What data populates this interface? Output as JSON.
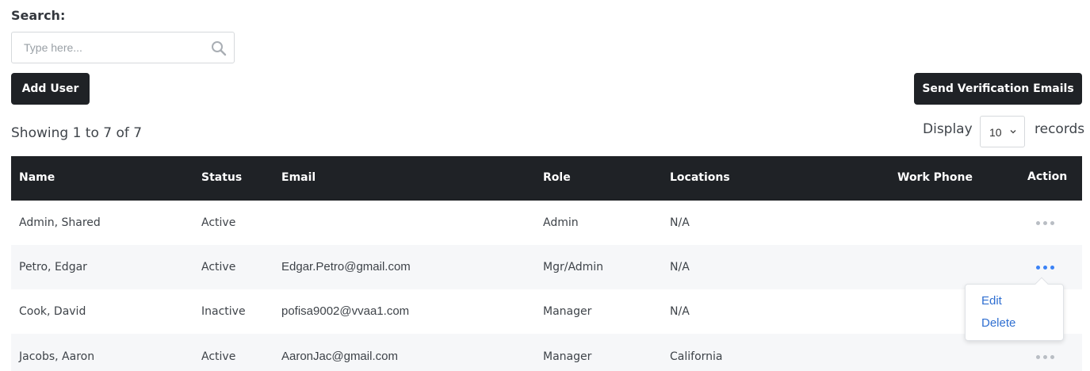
{
  "search": {
    "label": "Search:",
    "placeholder": "Type here...",
    "value": "",
    "icon": "search-icon"
  },
  "buttons": {
    "add_user": "Add User",
    "send_verification": "Send Verification Emails"
  },
  "summary": {
    "showing": "Showing 1 to 7 of 7"
  },
  "pagination": {
    "display_label": "Display",
    "page_size": "10",
    "records_label": "records"
  },
  "table": {
    "columns": {
      "name": "Name",
      "status": "Status",
      "email": "Email",
      "role": "Role",
      "locations": "Locations",
      "work_phone": "Work Phone",
      "action": "Action"
    },
    "rows": [
      {
        "name": "Admin, Shared",
        "status": "Active",
        "email": "",
        "role": "Admin",
        "locations": "N/A",
        "work_phone": ""
      },
      {
        "name": "Petro, Edgar",
        "status": "Active",
        "email": "Edgar.Petro@gmail.com",
        "role": "Mgr/Admin",
        "locations": "N/A",
        "work_phone": ""
      },
      {
        "name": "Cook, David",
        "status": "Inactive",
        "email": "pofisa9002@vvaa1.com",
        "role": "Manager",
        "locations": "N/A",
        "work_phone": ""
      },
      {
        "name": "Jacobs, Aaron",
        "status": "Active",
        "email": "AaronJac@gmail.com",
        "role": "Manager",
        "locations": "California",
        "work_phone": ""
      }
    ]
  },
  "action_menu": {
    "edit": "Edit",
    "delete": "Delete"
  },
  "colors": {
    "header_bg": "#1f2226",
    "button_bg": "#1f2226",
    "alt_row_bg": "#f6f7f9",
    "link": "#2f6fd1",
    "active_dots": "#3b82f6",
    "inactive_dots": "#b9bec4"
  }
}
